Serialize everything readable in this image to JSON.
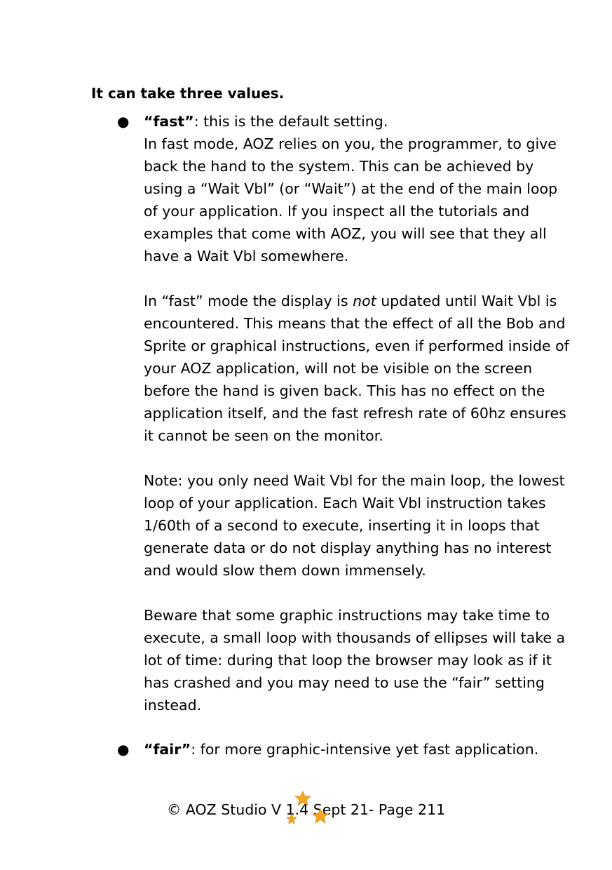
{
  "heading": "It can take three values.",
  "bullet_glyph": "●",
  "items": [
    {
      "term": "“fast”",
      "intro": ": this is the default setting.",
      "p1": "In fast mode, AOZ relies on you, the programmer, to give back the hand to the system. This can be achieved by using a “Wait Vbl” (or “Wait”) at the end of the main loop of your application. If you inspect all the tutorials and examples that come with AOZ, you will see that they all have a Wait Vbl somewhere.",
      "p2_before": "In “fast” mode the display is ",
      "p2_em": "not",
      "p2_after": " updated until Wait Vbl is encountered. This means that the effect of all the Bob and Sprite or graphical instructions, even if performed inside of your AOZ application, will not be visible on the screen before the hand is given back. This has no effect on the application itself, and the fast refresh rate of 60hz ensures it cannot be seen on the monitor.",
      "p3": "Note: you only need Wait Vbl for the main loop, the lowest loop of your application. Each Wait Vbl instruction takes 1/60th of a second to execute, inserting it in loops that generate data or do not display anything has no interest and would slow them down immensely.",
      "p4": "Beware that some graphic instructions may take time to execute, a small loop with thousands of ellipses will take a lot of time: during that loop the browser may look as if it has crashed and you may need to use the “fair” setting instead."
    },
    {
      "term": "“fair”",
      "intro": ": for more graphic-intensive yet fast application."
    }
  ],
  "footer": "© AOZ Studio V 1.4 Sept 21- Page 211",
  "star_color": "#f5a623"
}
